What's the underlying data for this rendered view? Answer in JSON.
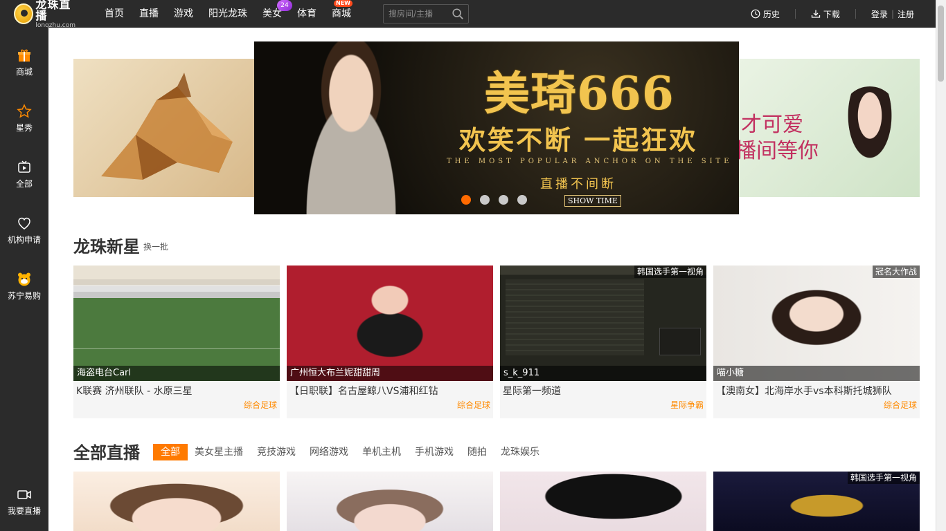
{
  "logo": {
    "cn": "龙珠直播",
    "en": "longzhu.com"
  },
  "nav": [
    {
      "label": "首页"
    },
    {
      "label": "直播"
    },
    {
      "label": "游戏"
    },
    {
      "label": "阳光龙珠"
    },
    {
      "label": "美女"
    },
    {
      "label": "体育"
    },
    {
      "label": "商城"
    }
  ],
  "nav_badges": {
    "new": "NEW",
    "heart": "24"
  },
  "search": {
    "placeholder": "搜房间/主播"
  },
  "topright": {
    "history": "历史",
    "download": "下载",
    "login": "登录",
    "divider": "|",
    "register": "注册"
  },
  "sidebar": [
    {
      "label": "商城",
      "icon": "gift-icon"
    },
    {
      "label": "星秀",
      "icon": "star-icon"
    },
    {
      "label": "全部",
      "icon": "tv-icon"
    },
    {
      "label": "机构申请",
      "icon": "heart-icon"
    },
    {
      "label": "苏宁易购",
      "icon": "suning-icon"
    },
    {
      "label": "我要直播",
      "icon": "camera-icon"
    }
  ],
  "banner": {
    "title": "美琦666",
    "subtitle": "欢笑不断 一起狂欢",
    "english": "THE MOST POPULAR ANCHOR ON THE SITE",
    "live_text": "直播不间断",
    "show_time": "SHOW TIME",
    "right_text_1": "才可爱",
    "right_text_2": "播间等你",
    "slides_total": 4,
    "slide_active": 1
  },
  "new_stars": {
    "title": "龙珠新星",
    "switch": "换一批",
    "cards": [
      {
        "anchor": "海盗电台Carl",
        "title": "K联赛 济州联队 - 水原三星",
        "category": "综合足球",
        "tag": ""
      },
      {
        "anchor": "广州恒大布兰妮甜甜周",
        "title": "【日职联】名古屋鲸八VS浦和红钻",
        "category": "综合足球",
        "tag": ""
      },
      {
        "anchor": "s_k_911",
        "title": "星际第一频道",
        "category": "星际争霸",
        "tag": "韩国选手第一视角"
      },
      {
        "anchor": "喵小糖",
        "title": "【澳南女】北海岸水手vs本科斯托城狮队",
        "category": "综合足球",
        "tag": "冠名大作战"
      }
    ]
  },
  "all_live": {
    "title": "全部直播",
    "filters": [
      "全部",
      "美女星主播",
      "竞技游戏",
      "网络游戏",
      "单机主机",
      "手机游戏",
      "随拍",
      "龙珠娱乐"
    ],
    "cards": [
      {
        "tag": ""
      },
      {
        "tag": ""
      },
      {
        "tag": ""
      },
      {
        "tag": "韩国选手第一视角"
      }
    ]
  },
  "colors": {
    "accent": "#ff7a00",
    "topbar": "#2b2b2b",
    "category": "#ff8a00"
  }
}
